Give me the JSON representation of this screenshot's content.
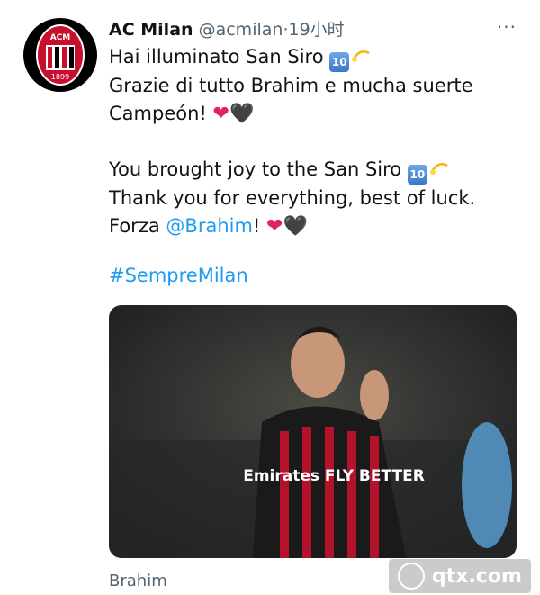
{
  "account": {
    "name": "AC Milan",
    "handle": "@acmilan",
    "sep": "·",
    "time": "19小时",
    "logo_text": "ACM",
    "logo_year": "1899"
  },
  "more_label": "···",
  "tweet": {
    "line1_prefix": "Hai illuminato San Siro",
    "line2": "Grazie di tutto Brahim e mucha suerte",
    "line3": "Campeón!",
    "line4_prefix": "You brought joy to the San Siro",
    "line5": "Thank you for everything, best of luck.",
    "line6_prefix": "Forza",
    "mention": "@Brahim",
    "line6_suffix": "!",
    "hashtag": "#SempreMilan",
    "emoji_ten": "10",
    "heart": "❤",
    "black_heart": "🖤"
  },
  "image": {
    "caption": "Brahim",
    "shirt_text": "Emirates FLY BETTER"
  },
  "watermark": {
    "text": "qtx.com"
  },
  "colors": {
    "link": "#1d9bf0",
    "secondary": "#536471",
    "milan_red": "#c8102e"
  }
}
